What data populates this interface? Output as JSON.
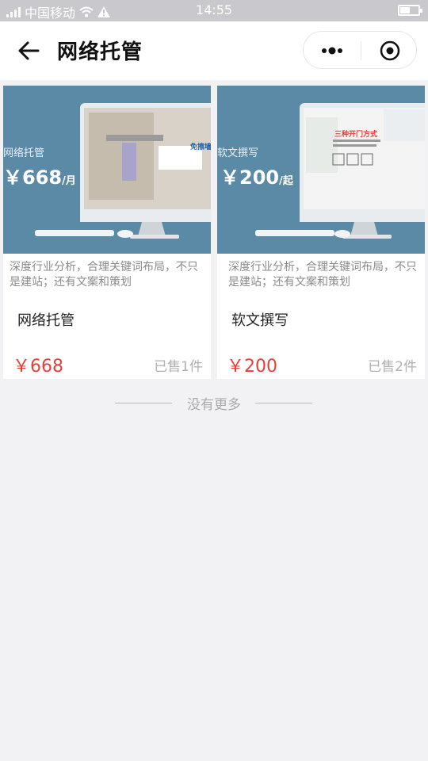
{
  "status_bar": {
    "carrier": "中国移动",
    "time": "14:55"
  },
  "nav": {
    "title": "网络托管"
  },
  "products": [
    {
      "banner_tag": "网络托管",
      "banner_price": "￥668",
      "banner_unit": "/月",
      "screen_text": "免擦墙",
      "description": "深度行业分析，合理关键词布局，不只是建站；还有文案和策划",
      "title": "网络托管",
      "price": "￥668",
      "sold": "已售1件"
    },
    {
      "banner_tag": "软文撰写",
      "banner_price": "￥200",
      "banner_unit": "/起",
      "screen_text": "三种开门方式",
      "description": "深度行业分析，合理关键词布局，不只是建站；还有文案和策划",
      "title": "软文撰写",
      "price": "￥200",
      "sold": "已售2件"
    }
  ],
  "footer": {
    "no_more": "没有更多"
  },
  "colors": {
    "accent_price": "#e5403a",
    "banner_bg": "#5a8aa5",
    "page_bg": "#f2f1f4"
  }
}
